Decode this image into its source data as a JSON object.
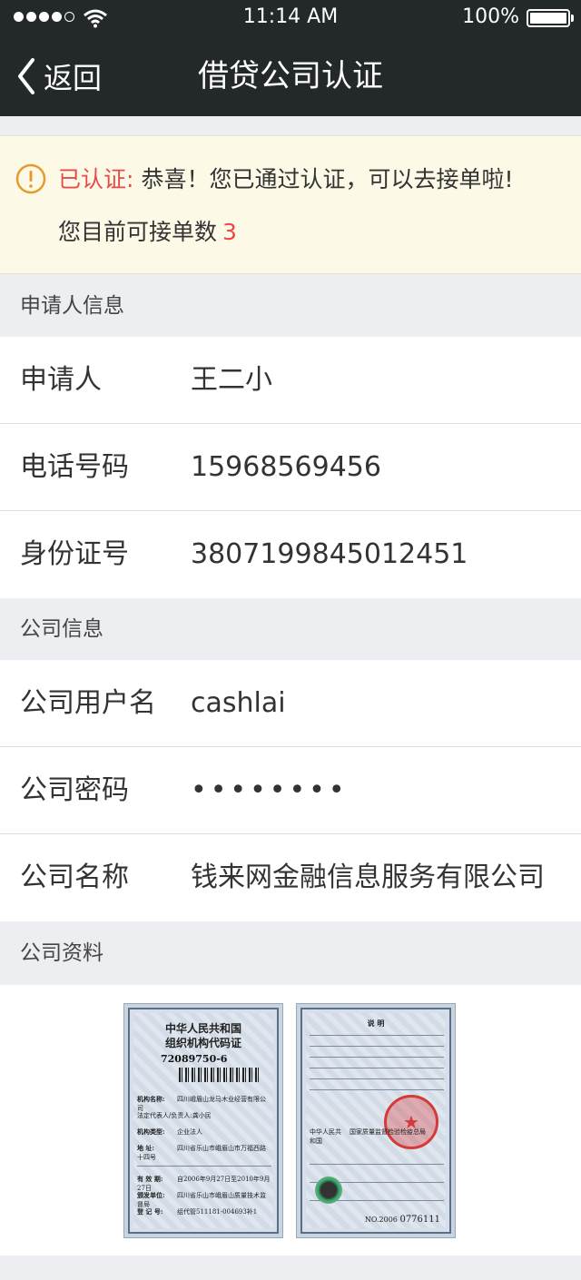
{
  "status_bar": {
    "time": "11:14 AM",
    "battery": "100%"
  },
  "nav": {
    "back_label": "返回",
    "title": "借贷公司认证"
  },
  "notice": {
    "status_label": "已认证:",
    "message": "恭喜！您已通过认证，可以去接单啦!",
    "count_label": "您目前可接单数",
    "count_value": "3"
  },
  "applicant": {
    "section_title": "申请人信息",
    "rows": [
      {
        "label": "申请人",
        "value": "王二小"
      },
      {
        "label": "电话号码",
        "value": "15968569456"
      },
      {
        "label": "身份证号",
        "value": "3807199845012451"
      }
    ]
  },
  "company": {
    "section_title": "公司信息",
    "rows": [
      {
        "label": "公司用户名",
        "value": "cashlai"
      },
      {
        "label": "公司密码",
        "value": "••••••••"
      },
      {
        "label": "公司名称",
        "value": "钱来网金融信息服务有限公司"
      }
    ]
  },
  "documents": {
    "section_title": "公司资料",
    "certificate": {
      "title_line1": "中华人民共和国",
      "title_line2": "组织机构代码证",
      "code": "72089750-6",
      "org_label": "机构名称:",
      "org_value": "四川峨眉山龙马木业经营有限公司",
      "rep_label": "法定代表人/负责人:",
      "rep_value": "龚小民",
      "type_label": "机构类型:",
      "type_value": "企业法人",
      "address_label": "地   址:",
      "address_value": "四川省乐山市峨眉山市万福西路十四号",
      "valid_label": "有 效 期:",
      "valid_value": "自2006年9月27日至2010年9月27日",
      "issuer_label": "颁发单位:",
      "issuer_value": "四川省乐山市峨眉山质量技术监督局",
      "reg_label": "登 记 号:",
      "reg_value": "组代管511181-004693补1",
      "back_heading": "说   明",
      "back_country": "中华人民共和国",
      "back_bureau": "国家质量监督检验检疫总局",
      "back_no_label": "NO.2006",
      "back_no_value": "0776111"
    }
  },
  "colors": {
    "nav_bg": "#23282b",
    "accent_red": "#e84a4a",
    "warning_icon": "#e8992e",
    "notice_bg": "#fdf9e7"
  }
}
